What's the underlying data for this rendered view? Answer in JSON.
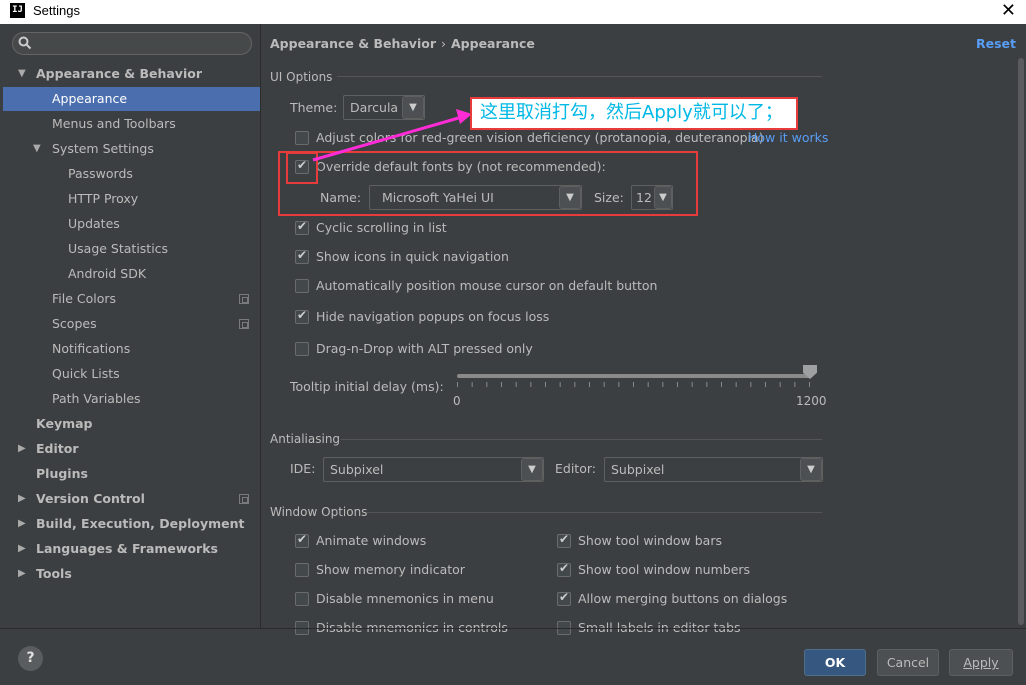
{
  "window": {
    "title": "Settings",
    "logo": "IJ",
    "close_glyph": "✕"
  },
  "sidebar": {
    "search_placeholder": "",
    "items": [
      {
        "label": "Appearance & Behavior",
        "level": 0,
        "bold": true,
        "arrow": "▼"
      },
      {
        "label": "Appearance",
        "level": 1,
        "selected": true
      },
      {
        "label": "Menus and Toolbars",
        "level": 1
      },
      {
        "label": "System Settings",
        "level": 1,
        "arrow": "▼"
      },
      {
        "label": "Passwords",
        "level": 2
      },
      {
        "label": "HTTP Proxy",
        "level": 2
      },
      {
        "label": "Updates",
        "level": 2
      },
      {
        "label": "Usage Statistics",
        "level": 2
      },
      {
        "label": "Android SDK",
        "level": 2
      },
      {
        "label": "File Colors",
        "level": 1,
        "icon": true
      },
      {
        "label": "Scopes",
        "level": 1,
        "icon": true
      },
      {
        "label": "Notifications",
        "level": 1
      },
      {
        "label": "Quick Lists",
        "level": 1
      },
      {
        "label": "Path Variables",
        "level": 1
      },
      {
        "label": "Keymap",
        "level": 0,
        "bold": true
      },
      {
        "label": "Editor",
        "level": 0,
        "bold": true,
        "arrow": "▶"
      },
      {
        "label": "Plugins",
        "level": 0,
        "bold": true
      },
      {
        "label": "Version Control",
        "level": 0,
        "bold": true,
        "arrow": "▶",
        "icon": true
      },
      {
        "label": "Build, Execution, Deployment",
        "level": 0,
        "bold": true,
        "arrow": "▶"
      },
      {
        "label": "Languages & Frameworks",
        "level": 0,
        "bold": true,
        "arrow": "▶"
      },
      {
        "label": "Tools",
        "level": 0,
        "bold": true,
        "arrow": "▶"
      }
    ]
  },
  "main": {
    "breadcrumb": [
      "Appearance & Behavior",
      "Appearance"
    ],
    "breadcrumb_sep": "›",
    "reset_label": "Reset",
    "ui_options": {
      "title": "UI Options",
      "theme_label": "Theme:",
      "theme_value": "Darcula",
      "adjust_colors": {
        "label": "Adjust colors for red-green vision deficiency (protanopia, deuteranopia)",
        "checked": false
      },
      "how_it_works": "How it works",
      "override_fonts": {
        "label": "Override default fonts by (not recommended):",
        "checked": true
      },
      "font_name_label": "Name:",
      "font_name_value": "Microsoft YaHei UI",
      "font_size_label": "Size:",
      "font_size_value": "12",
      "cyclic_scrolling": {
        "label": "Cyclic scrolling in list",
        "checked": true
      },
      "show_icons": {
        "label": "Show icons in quick navigation",
        "checked": true
      },
      "auto_position": {
        "label": "Automatically position mouse cursor on default button",
        "checked": false
      },
      "hide_popups": {
        "label": "Hide navigation popups on focus loss",
        "checked": true
      },
      "drag_drop": {
        "label": "Drag-n-Drop with ALT pressed only",
        "checked": false
      },
      "tooltip_label": "Tooltip initial delay (ms):",
      "tooltip_min": "0",
      "tooltip_max": "1200",
      "tooltip_value_fraction": 1.0
    },
    "antialiasing": {
      "title": "Antialiasing",
      "ide_label": "IDE:",
      "ide_value": "Subpixel",
      "editor_label": "Editor:",
      "editor_value": "Subpixel"
    },
    "window_options": {
      "title": "Window Options",
      "animate_windows": {
        "label": "Animate windows",
        "checked": true
      },
      "show_memory": {
        "label": "Show memory indicator",
        "checked": false
      },
      "disable_mnemonics_menu": {
        "label": "Disable mnemonics in menu",
        "checked": false
      },
      "disable_mnemonics_controls": {
        "label": "Disable mnemonics in controls",
        "checked": false
      },
      "show_tool_window_bars": {
        "label": "Show tool window bars",
        "checked": true
      },
      "show_tool_window_numbers": {
        "label": "Show tool window numbers",
        "checked": true
      },
      "allow_merging": {
        "label": "Allow merging buttons on dialogs",
        "checked": true
      },
      "small_labels": {
        "label": "Small labels in editor tabs",
        "checked": false
      }
    }
  },
  "annotation": {
    "callout_text": "这里取消打勾，然后Apply就可以了；",
    "color": "#e83c3c",
    "arrow_color": "#ff2bd6"
  },
  "footer": {
    "help_label": "?",
    "ok_label": "OK",
    "cancel_label": "Cancel",
    "apply_label": "Apply"
  },
  "colors": {
    "background": "#3c3f41",
    "selection": "#4b6eaf",
    "link": "#589df6",
    "text": "#bbbbbb"
  }
}
